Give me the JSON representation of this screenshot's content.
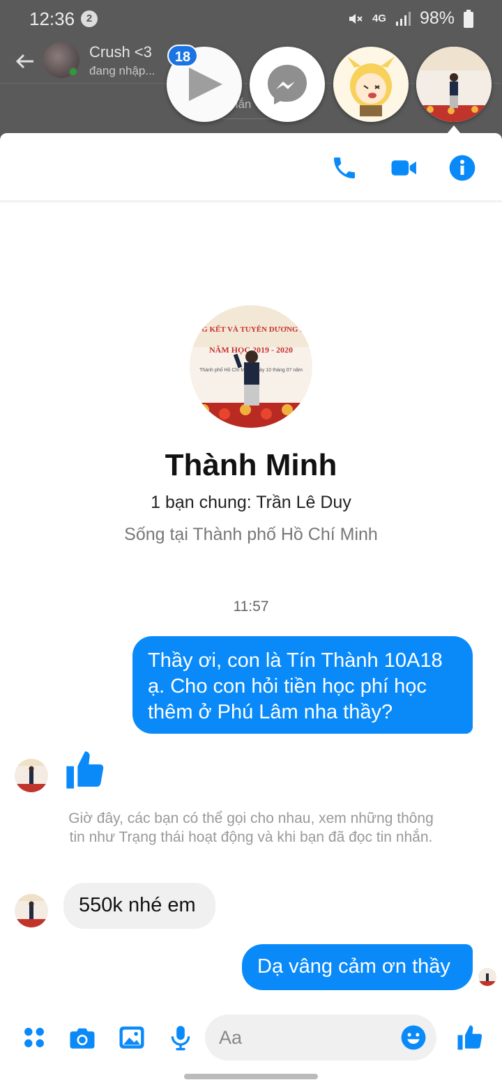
{
  "status_bar": {
    "time": "12:36",
    "notification_count": "2",
    "network": "4G",
    "battery": "98%"
  },
  "background_chat": {
    "contact_name": "Crush <3",
    "contact_status": "đang nhập...",
    "hint_fragment": "hắn"
  },
  "chat_heads": {
    "badge_count": "18",
    "items": [
      {
        "name": "play-chat-head"
      },
      {
        "name": "messenger-chat-head"
      },
      {
        "name": "anime-sticker-chat-head"
      },
      {
        "name": "thanh-minh-chat-head"
      }
    ]
  },
  "profile": {
    "name": "Thành Minh",
    "mutual_friends": "1 bạn chung: Trần Lê Duy",
    "location": "Sống tại Thành phố Hồ Chí Minh",
    "photo_banner_top": "NG KẾT VÀ TUYÊN DƯƠNG H",
    "photo_banner_year": "NĂM HỌC 2019 - 2020",
    "photo_banner_place": "Thành phố Hồ Chí Minh, ngày 10 tháng 07 năm"
  },
  "conversation": {
    "timestamp": "11:57",
    "messages": [
      {
        "sender": "me",
        "text": "Thầy ơi, con là Tín Thành 10A18 ạ. Cho con hỏi tiền học phí học thêm ở Phú Lâm nha thầy?"
      },
      {
        "sender": "them",
        "type": "like-sticker"
      },
      {
        "sender": "them",
        "text": "550k nhé em"
      },
      {
        "sender": "me",
        "text": "Dạ vâng cảm ơn thầy"
      }
    ],
    "system_note": "Giờ đây, các bạn có thể gọi cho nhau, xem những thông tin như Trạng thái hoạt động và khi bạn đã đọc tin nhắn."
  },
  "composer": {
    "placeholder": "Aa"
  },
  "icons": {
    "accent_color": "#0a8af9",
    "brand_blue": "#1b74e4",
    "call": "phone-icon",
    "video": "video-camera-icon",
    "info": "info-icon",
    "menu": "four-dots-icon",
    "camera": "camera-icon",
    "gallery": "image-icon",
    "mic": "microphone-icon",
    "emoji": "smiley-icon",
    "like": "thumbs-up-icon"
  }
}
